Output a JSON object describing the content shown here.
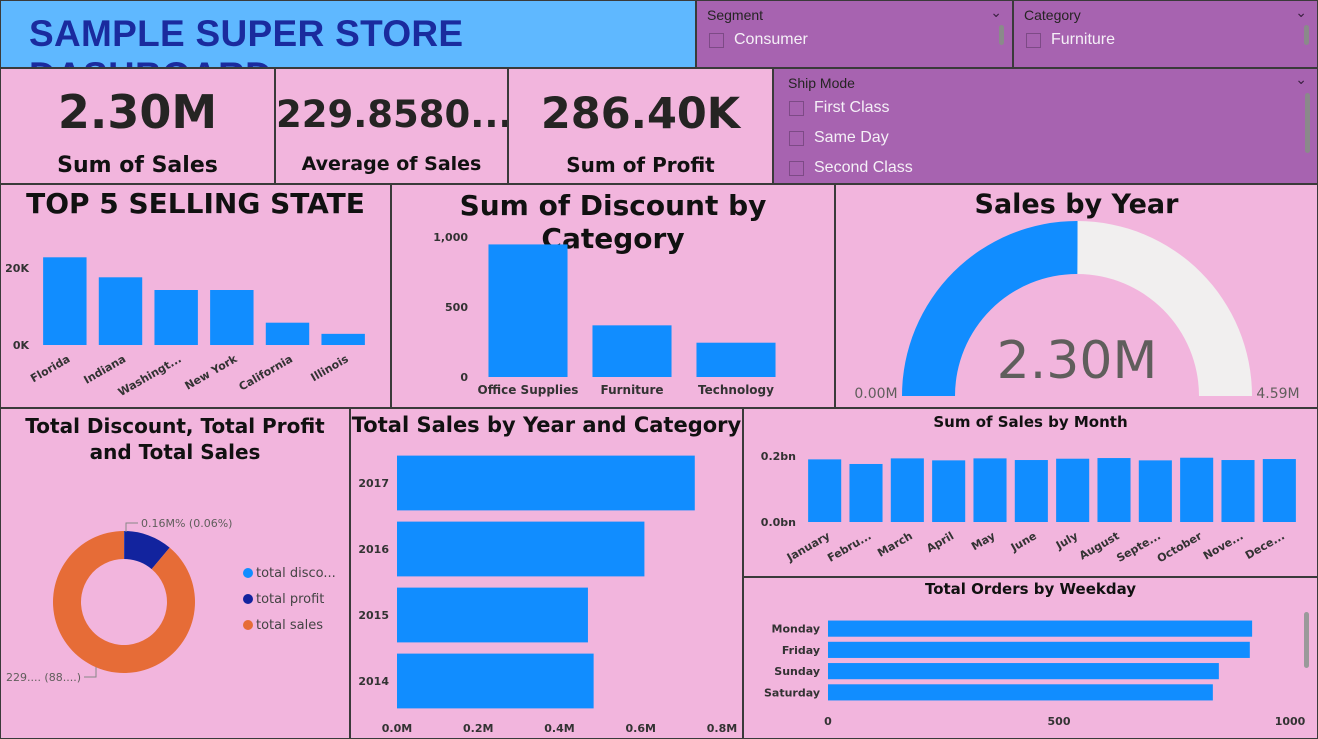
{
  "header": {
    "title": "SAMPLE SUPER STORE DASHBOARD"
  },
  "colors": {
    "bar": "#118dff",
    "dark_blue": "#12239e",
    "orange": "#e66c37",
    "gauge_bg": "#f1efef",
    "slicer_bg": "#a763b0",
    "page_bg": "#f2b5dd"
  },
  "slicers": {
    "segment": {
      "title": "Segment",
      "items": [
        "Consumer"
      ]
    },
    "category": {
      "title": "Category",
      "items": [
        "Furniture"
      ]
    },
    "ship_mode": {
      "title": "Ship Mode",
      "items": [
        "First Class",
        "Same Day",
        "Second Class"
      ]
    }
  },
  "kpis": {
    "sales": {
      "value": "2.30M",
      "label": "Sum of Sales"
    },
    "avg": {
      "value": "229.8580...",
      "label": "Average of Sales"
    },
    "profit": {
      "value": "286.40K",
      "label": "Sum of Profit"
    }
  },
  "chart_data": [
    {
      "id": "top5",
      "type": "bar",
      "title": "TOP 5 SELLING STATE",
      "categories": [
        "Florida",
        "Indiana",
        "Washingt...",
        "New York",
        "California",
        "Illinois"
      ],
      "values": [
        22800,
        17600,
        14300,
        14300,
        5800,
        2900
      ],
      "ticks": [
        {
          "v": 0,
          "label": "0K"
        },
        {
          "v": 20000,
          "label": "20K"
        }
      ],
      "ylim": [
        0,
        26000
      ]
    },
    {
      "id": "discount",
      "type": "bar",
      "title": "Sum of Discount by Category",
      "categories": [
        "Office Supplies",
        "Furniture",
        "Technology"
      ],
      "values": [
        947,
        369,
        245
      ],
      "ticks": [
        {
          "v": 0,
          "label": "0"
        },
        {
          "v": 500,
          "label": "500"
        },
        {
          "v": 1000,
          "label": "1,000"
        }
      ],
      "ylim": [
        0,
        1000
      ]
    },
    {
      "id": "gauge",
      "type": "gauge",
      "title": "Sales by Year",
      "value": 2.3,
      "value_label": "2.30M",
      "min_label": "0.00M",
      "max_label": "4.59M",
      "min": 0,
      "max": 4.59
    },
    {
      "id": "donut",
      "type": "pie",
      "title": "Total Discount, Total Profit and Total Sales",
      "series": [
        {
          "name": "total disco...",
          "value": 0.16,
          "color": "#118dff"
        },
        {
          "name": "total profit",
          "value": 28.6,
          "color": "#12239e"
        },
        {
          "name": "total sales",
          "value": 229.9,
          "color": "#e66c37"
        }
      ],
      "labels": {
        "top": "0.16M% (0.06%)",
        "bottom": "229.... (88....)"
      }
    },
    {
      "id": "year_cat",
      "type": "bar",
      "orientation": "horizontal",
      "title": "Total Sales by Year and Category",
      "categories": [
        "2017",
        "2016",
        "2015",
        "2014"
      ],
      "values": [
        733000,
        609000,
        470000,
        484000
      ],
      "ticks": [
        {
          "v": 0,
          "label": "0.0M"
        },
        {
          "v": 200000,
          "label": "0.2M"
        },
        {
          "v": 400000,
          "label": "0.4M"
        },
        {
          "v": 600000,
          "label": "0.6M"
        },
        {
          "v": 800000,
          "label": "0.8M"
        }
      ],
      "xlim": [
        0,
        800000
      ]
    },
    {
      "id": "month",
      "type": "bar",
      "title": "Sum of Sales by Month",
      "categories": [
        "January",
        "Febru...",
        "March",
        "April",
        "May",
        "June",
        "July",
        "August",
        "Septe...",
        "October",
        "Nove...",
        "Dece..."
      ],
      "values": [
        0.19,
        0.176,
        0.193,
        0.187,
        0.193,
        0.188,
        0.192,
        0.194,
        0.187,
        0.195,
        0.188,
        0.191
      ],
      "ticks": [
        {
          "v": 0,
          "label": "0.0bn"
        },
        {
          "v": 0.2,
          "label": "0.2bn"
        }
      ],
      "ylim": [
        0,
        0.27
      ]
    },
    {
      "id": "weekday",
      "type": "bar",
      "orientation": "horizontal",
      "title": "Total Orders by Weekday",
      "categories": [
        "Monday",
        "Friday",
        "Sunday",
        "Saturday"
      ],
      "values": [
        918,
        913,
        846,
        833
      ],
      "ticks": [
        {
          "v": 0,
          "label": "0"
        },
        {
          "v": 500,
          "label": "500"
        },
        {
          "v": 1000,
          "label": "1000"
        }
      ],
      "xlim": [
        0,
        1000
      ]
    }
  ]
}
